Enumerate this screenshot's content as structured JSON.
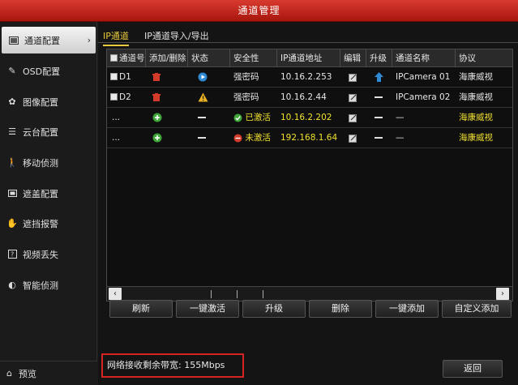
{
  "window": {
    "title": "通道管理"
  },
  "sidebar": {
    "items": [
      {
        "label": "通道配置",
        "icon": "channel-config-icon",
        "active": true
      },
      {
        "label": "OSD配置",
        "icon": "osd-icon"
      },
      {
        "label": "图像配置",
        "icon": "image-icon"
      },
      {
        "label": "云台配置",
        "icon": "ptz-icon"
      },
      {
        "label": "移动侦测",
        "icon": "motion-icon"
      },
      {
        "label": "遮盖配置",
        "icon": "mask-icon"
      },
      {
        "label": "遮挡报警",
        "icon": "tamper-icon"
      },
      {
        "label": "视频丢失",
        "icon": "video-loss-icon"
      },
      {
        "label": "智能侦测",
        "icon": "smart-icon"
      }
    ],
    "preview_label": "预览"
  },
  "tabs": [
    {
      "label": "IP通道",
      "active": true
    },
    {
      "label": "IP通道导入/导出"
    }
  ],
  "table": {
    "headers": [
      "通道号",
      "添加/删除",
      "状态",
      "安全性",
      "IP通道地址",
      "编辑",
      "升级",
      "通道名称",
      "协议"
    ],
    "rows": [
      {
        "channel": "D1",
        "action": "delete",
        "status": "play",
        "security": "强密码",
        "ip": "10.16.2.253",
        "upgrade": "up",
        "name": "IPCamera 01",
        "protocol": "海康威视",
        "highlight": false
      },
      {
        "channel": "D2",
        "action": "delete",
        "status": "warning",
        "security": "强密码",
        "ip": "10.16.2.44",
        "upgrade": "dash",
        "name": "IPCamera 02",
        "protocol": "海康威视",
        "highlight": false
      },
      {
        "channel": "...",
        "action": "add",
        "status": "dash",
        "security": "已激活",
        "security_icon": "ok",
        "ip": "10.16.2.202",
        "upgrade": "dash",
        "name": "—",
        "protocol": "海康威视",
        "highlight": true
      },
      {
        "channel": "...",
        "action": "add",
        "status": "dash",
        "security": "未激活",
        "security_icon": "no",
        "ip": "192.168.1.64",
        "upgrade": "dash",
        "name": "—",
        "protocol": "海康威视",
        "highlight": true
      }
    ]
  },
  "buttons": {
    "refresh": "刷新",
    "activate_all": "一键激活",
    "upgrade": "升级",
    "delete": "删除",
    "add_all": "一键添加",
    "custom_add": "自定义添加"
  },
  "status": {
    "bandwidth_label": "网络接收剩余带宽:",
    "bandwidth_value": "155Mbps"
  },
  "back_label": "返回"
}
